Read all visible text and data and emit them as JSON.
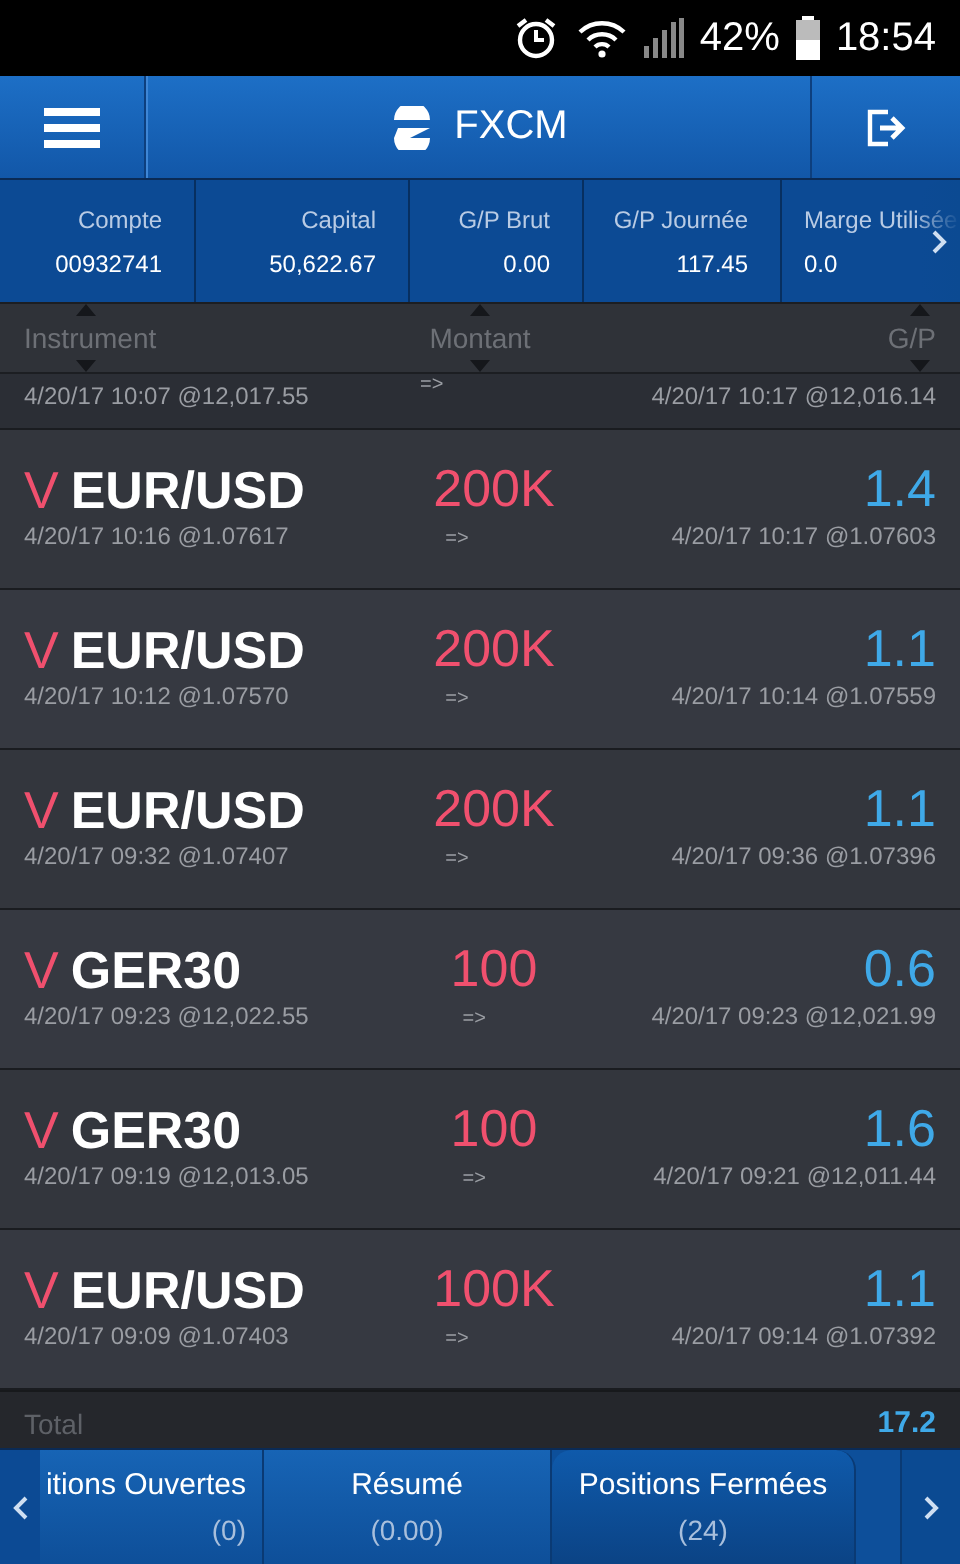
{
  "status_bar": {
    "battery": "42%",
    "time": "18:54"
  },
  "header": {
    "title": "FXCM"
  },
  "summary": [
    {
      "label": "Compte",
      "value": "00932741"
    },
    {
      "label": "Capital",
      "value": "50,622.67"
    },
    {
      "label": "G/P Brut",
      "value": "0.00"
    },
    {
      "label": "G/P Journée",
      "value": "117.45"
    },
    {
      "label": "Marge Utilisée",
      "value": "0.0"
    }
  ],
  "columns": [
    "Instrument",
    "Montant",
    "G/P"
  ],
  "partial_row": {
    "open": "4/20/17 10:07 @12,017.55",
    "arrow": "=>",
    "close": "4/20/17 10:17 @12,016.14"
  },
  "rows": [
    {
      "side": "V",
      "instrument": "EUR/USD",
      "amount": "200K",
      "pl": "1.4",
      "open": "4/20/17 10:16 @1.07617",
      "arrow": "=>",
      "close": "4/20/17 10:17 @1.07603"
    },
    {
      "side": "V",
      "instrument": "EUR/USD",
      "amount": "200K",
      "pl": "1.1",
      "open": "4/20/17 10:12 @1.07570",
      "arrow": "=>",
      "close": "4/20/17 10:14 @1.07559"
    },
    {
      "side": "V",
      "instrument": "EUR/USD",
      "amount": "200K",
      "pl": "1.1",
      "open": "4/20/17 09:32 @1.07407",
      "arrow": "=>",
      "close": "4/20/17 09:36 @1.07396"
    },
    {
      "side": "V",
      "instrument": "GER30",
      "amount": "100",
      "pl": "0.6",
      "open": "4/20/17 09:23 @12,022.55",
      "arrow": "=>",
      "close": "4/20/17 09:23 @12,021.99"
    },
    {
      "side": "V",
      "instrument": "GER30",
      "amount": "100",
      "pl": "1.6",
      "open": "4/20/17 09:19 @12,013.05",
      "arrow": "=>",
      "close": "4/20/17 09:21 @12,011.44"
    },
    {
      "side": "V",
      "instrument": "EUR/USD",
      "amount": "100K",
      "pl": "1.1",
      "open": "4/20/17 09:09 @1.07403",
      "arrow": "=>",
      "close": "4/20/17 09:14 @1.07392"
    }
  ],
  "total": {
    "label": "Total",
    "value": "17.2"
  },
  "tabs": [
    {
      "label": "itions Ouvertes",
      "count": "(0)",
      "selected": false
    },
    {
      "label": "Résumé",
      "count": "(0.00)",
      "selected": false
    },
    {
      "label": "Positions Fermées",
      "count": "(24)",
      "selected": true
    }
  ]
}
